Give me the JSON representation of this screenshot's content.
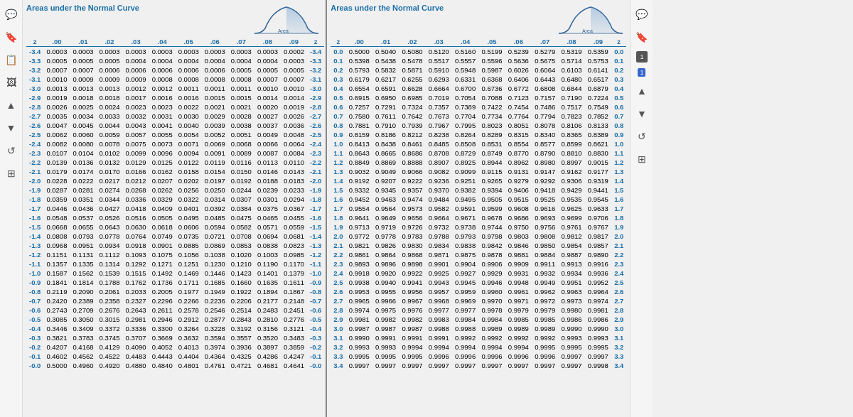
{
  "left_panel": {
    "title": "Areas under the Normal Curve",
    "columns": [
      "z",
      ".00",
      ".01",
      ".02",
      ".03",
      ".04",
      ".05",
      ".06",
      ".07",
      ".08",
      ".09",
      "z"
    ],
    "rows": [
      [
        "-3.4",
        "0.0003",
        "0.0003",
        "0.0003",
        "0.0003",
        "0.0003",
        "0.0003",
        "0.0003",
        "0.0003",
        "0.0003",
        "0.0002",
        "-3.4"
      ],
      [
        "-3.3",
        "0.0005",
        "0.0005",
        "0.0005",
        "0.0004",
        "0.0004",
        "0.0004",
        "0.0004",
        "0.0004",
        "0.0004",
        "0.0003",
        "-3.3"
      ],
      [
        "-3.2",
        "0.0007",
        "0.0007",
        "0.0006",
        "0.0006",
        "0.0006",
        "0.0006",
        "0.0006",
        "0.0005",
        "0.0005",
        "0.0005",
        "-3.2"
      ],
      [
        "-3.1",
        "0.0010",
        "0.0009",
        "0.0009",
        "0.0009",
        "0.0008",
        "0.0008",
        "0.0008",
        "0.0008",
        "0.0007",
        "0.0007",
        "-3.1"
      ],
      [
        "-3.0",
        "0.0013",
        "0.0013",
        "0.0013",
        "0.0012",
        "0.0012",
        "0.0011",
        "0.0011",
        "0.0011",
        "0.0010",
        "0.0010",
        "-3.0"
      ],
      [
        "-2.9",
        "0.0019",
        "0.0018",
        "0.0018",
        "0.0017",
        "0.0016",
        "0.0016",
        "0.0015",
        "0.0015",
        "0.0014",
        "0.0014",
        "-2.9"
      ],
      [
        "-2.8",
        "0.0026",
        "0.0025",
        "0.0024",
        "0.0023",
        "0.0023",
        "0.0022",
        "0.0021",
        "0.0021",
        "0.0020",
        "0.0019",
        "-2.8"
      ],
      [
        "-2.7",
        "0.0035",
        "0.0034",
        "0.0033",
        "0.0032",
        "0.0031",
        "0.0030",
        "0.0029",
        "0.0028",
        "0.0027",
        "0.0026",
        "-2.7"
      ],
      [
        "-2.6",
        "0.0047",
        "0.0045",
        "0.0044",
        "0.0043",
        "0.0041",
        "0.0040",
        "0.0039",
        "0.0038",
        "0.0037",
        "0.0036",
        "-2.6"
      ],
      [
        "-2.5",
        "0.0062",
        "0.0060",
        "0.0059",
        "0.0057",
        "0.0055",
        "0.0054",
        "0.0052",
        "0.0051",
        "0.0049",
        "0.0048",
        "-2.5"
      ],
      [
        "-2.4",
        "0.0082",
        "0.0080",
        "0.0078",
        "0.0075",
        "0.0073",
        "0.0071",
        "0.0069",
        "0.0068",
        "0.0066",
        "0.0064",
        "-2.4"
      ],
      [
        "-2.3",
        "0.0107",
        "0.0104",
        "0.0102",
        "0.0099",
        "0.0096",
        "0.0094",
        "0.0091",
        "0.0089",
        "0.0087",
        "0.0084",
        "-2.3"
      ],
      [
        "-2.2",
        "0.0139",
        "0.0136",
        "0.0132",
        "0.0129",
        "0.0125",
        "0.0122",
        "0.0119",
        "0.0116",
        "0.0113",
        "0.0110",
        "-2.2"
      ],
      [
        "-2.1",
        "0.0179",
        "0.0174",
        "0.0170",
        "0.0166",
        "0.0162",
        "0.0158",
        "0.0154",
        "0.0150",
        "0.0146",
        "0.0143",
        "-2.1"
      ],
      [
        "-2.0",
        "0.0228",
        "0.0222",
        "0.0217",
        "0.0212",
        "0.0207",
        "0.0202",
        "0.0197",
        "0.0192",
        "0.0188",
        "0.0183",
        "-2.0"
      ],
      [
        "-1.9",
        "0.0287",
        "0.0281",
        "0.0274",
        "0.0268",
        "0.0262",
        "0.0256",
        "0.0250",
        "0.0244",
        "0.0239",
        "0.0233",
        "-1.9"
      ],
      [
        "-1.8",
        "0.0359",
        "0.0351",
        "0.0344",
        "0.0336",
        "0.0329",
        "0.0322",
        "0.0314",
        "0.0307",
        "0.0301",
        "0.0294",
        "-1.8"
      ],
      [
        "-1.7",
        "0.0446",
        "0.0436",
        "0.0427",
        "0.0418",
        "0.0409",
        "0.0401",
        "0.0392",
        "0.0384",
        "0.0375",
        "0.0367",
        "-1.7"
      ],
      [
        "-1.6",
        "0.0548",
        "0.0537",
        "0.0526",
        "0.0516",
        "0.0505",
        "0.0495",
        "0.0485",
        "0.0475",
        "0.0465",
        "0.0455",
        "-1.6"
      ],
      [
        "-1.5",
        "0.0668",
        "0.0655",
        "0.0643",
        "0.0630",
        "0.0618",
        "0.0606",
        "0.0594",
        "0.0582",
        "0.0571",
        "0.0559",
        "-1.5"
      ],
      [
        "-1.4",
        "0.0808",
        "0.0793",
        "0.0778",
        "0.0764",
        "0.0749",
        "0.0735",
        "0.0721",
        "0.0708",
        "0.0694",
        "0.0681",
        "-1.4"
      ],
      [
        "-1.3",
        "0.0968",
        "0.0951",
        "0.0934",
        "0.0918",
        "0.0901",
        "0.0885",
        "0.0869",
        "0.0853",
        "0.0838",
        "0.0823",
        "-1.3"
      ],
      [
        "-1.2",
        "0.1151",
        "0.1131",
        "0.1112",
        "0.1093",
        "0.1075",
        "0.1056",
        "0.1038",
        "0.1020",
        "0.1003",
        "0.0985",
        "-1.2"
      ],
      [
        "-1.1",
        "0.1357",
        "0.1335",
        "0.1314",
        "0.1292",
        "0.1271",
        "0.1251",
        "0.1230",
        "0.1210",
        "0.1190",
        "0.1170",
        "-1.1"
      ],
      [
        "-1.0",
        "0.1587",
        "0.1562",
        "0.1539",
        "0.1515",
        "0.1492",
        "0.1469",
        "0.1446",
        "0.1423",
        "0.1401",
        "0.1379",
        "-1.0"
      ],
      [
        "-0.9",
        "0.1841",
        "0.1814",
        "0.1788",
        "0.1762",
        "0.1736",
        "0.1711",
        "0.1685",
        "0.1660",
        "0.1635",
        "0.1611",
        "-0.9"
      ],
      [
        "-0.8",
        "0.2119",
        "0.2090",
        "0.2061",
        "0.2033",
        "0.2005",
        "0.1977",
        "0.1949",
        "0.1922",
        "0.1894",
        "0.1867",
        "-0.8"
      ],
      [
        "-0.7",
        "0.2420",
        "0.2389",
        "0.2358",
        "0.2327",
        "0.2296",
        "0.2266",
        "0.2236",
        "0.2206",
        "0.2177",
        "0.2148",
        "-0.7"
      ],
      [
        "-0.6",
        "0.2743",
        "0.2709",
        "0.2676",
        "0.2643",
        "0.2611",
        "0.2578",
        "0.2546",
        "0.2514",
        "0.2483",
        "0.2451",
        "-0.6"
      ],
      [
        "-0.5",
        "0.3085",
        "0.3050",
        "0.3015",
        "0.2981",
        "0.2946",
        "0.2912",
        "0.2877",
        "0.2843",
        "0.2810",
        "0.2776",
        "-0.5"
      ],
      [
        "-0.4",
        "0.3446",
        "0.3409",
        "0.3372",
        "0.3336",
        "0.3300",
        "0.3264",
        "0.3228",
        "0.3192",
        "0.3156",
        "0.3121",
        "-0.4"
      ],
      [
        "-0.3",
        "0.3821",
        "0.3783",
        "0.3745",
        "0.3707",
        "0.3669",
        "0.3632",
        "0.3594",
        "0.3557",
        "0.3520",
        "0.3483",
        "-0.3"
      ],
      [
        "-0.2",
        "0.4207",
        "0.4168",
        "0.4129",
        "0.4090",
        "0.4052",
        "0.4013",
        "0.3974",
        "0.3936",
        "0.3897",
        "0.3859",
        "-0.2"
      ],
      [
        "-0.1",
        "0.4602",
        "0.4562",
        "0.4522",
        "0.4483",
        "0.4443",
        "0.4404",
        "0.4364",
        "0.4325",
        "0.4286",
        "0.4247",
        "-0.1"
      ],
      [
        "-0.0",
        "0.5000",
        "0.4960",
        "0.4920",
        "0.4880",
        "0.4840",
        "0.4801",
        "0.4761",
        "0.4721",
        "0.4681",
        "0.4641",
        "-0.0"
      ]
    ]
  },
  "right_panel": {
    "title": "Areas under the Normal Curve",
    "columns": [
      "z",
      ".00",
      ".01",
      ".02",
      ".03",
      ".04",
      ".05",
      ".06",
      ".07",
      ".08",
      ".09",
      "z"
    ],
    "rows": [
      [
        "0.0",
        "0.5000",
        "0.5040",
        "0.5080",
        "0.5120",
        "0.5160",
        "0.5199",
        "0.5239",
        "0.5279",
        "0.5319",
        "0.5359",
        "0.0"
      ],
      [
        "0.1",
        "0.5398",
        "0.5438",
        "0.5478",
        "0.5517",
        "0.5557",
        "0.5596",
        "0.5636",
        "0.5675",
        "0.5714",
        "0.5753",
        "0.1"
      ],
      [
        "0.2",
        "0.5793",
        "0.5832",
        "0.5871",
        "0.5910",
        "0.5948",
        "0.5987",
        "0.6026",
        "0.6064",
        "0.6103",
        "0.6141",
        "0.2"
      ],
      [
        "0.3",
        "0.6179",
        "0.6217",
        "0.6255",
        "0.6293",
        "0.6331",
        "0.6368",
        "0.6406",
        "0.6443",
        "0.6480",
        "0.6517",
        "0.3"
      ],
      [
        "0.4",
        "0.6554",
        "0.6591",
        "0.6628",
        "0.6664",
        "0.6700",
        "0.6736",
        "0.6772",
        "0.6808",
        "0.6844",
        "0.6879",
        "0.4"
      ],
      [
        "0.5",
        "0.6915",
        "0.6950",
        "0.6985",
        "0.7019",
        "0.7054",
        "0.7088",
        "0.7123",
        "0.7157",
        "0.7190",
        "0.7224",
        "0.5"
      ],
      [
        "0.6",
        "0.7257",
        "0.7291",
        "0.7324",
        "0.7357",
        "0.7389",
        "0.7422",
        "0.7454",
        "0.7486",
        "0.7517",
        "0.7549",
        "0.6"
      ],
      [
        "0.7",
        "0.7580",
        "0.7611",
        "0.7642",
        "0.7673",
        "0.7704",
        "0.7734",
        "0.7764",
        "0.7794",
        "0.7823",
        "0.7852",
        "0.7"
      ],
      [
        "0.8",
        "0.7881",
        "0.7910",
        "0.7939",
        "0.7967",
        "0.7995",
        "0.8023",
        "0.8051",
        "0.8078",
        "0.8106",
        "0.8133",
        "0.8"
      ],
      [
        "0.9",
        "0.8159",
        "0.8186",
        "0.8212",
        "0.8238",
        "0.8264",
        "0.8289",
        "0.8315",
        "0.8340",
        "0.8365",
        "0.8389",
        "0.9"
      ],
      [
        "1.0",
        "0.8413",
        "0.8438",
        "0.8461",
        "0.8485",
        "0.8508",
        "0.8531",
        "0.8554",
        "0.8577",
        "0.8599",
        "0.8621",
        "1.0"
      ],
      [
        "1.1",
        "0.8643",
        "0.8665",
        "0.8686",
        "0.8708",
        "0.8729",
        "0.8749",
        "0.8770",
        "0.8790",
        "0.8810",
        "0.8830",
        "1.1"
      ],
      [
        "1.2",
        "0.8849",
        "0.8869",
        "0.8888",
        "0.8907",
        "0.8925",
        "0.8944",
        "0.8962",
        "0.8980",
        "0.8997",
        "0.9015",
        "1.2"
      ],
      [
        "1.3",
        "0.9032",
        "0.9049",
        "0.9066",
        "0.9082",
        "0.9099",
        "0.9115",
        "0.9131",
        "0.9147",
        "0.9162",
        "0.9177",
        "1.3"
      ],
      [
        "1.4",
        "0.9192",
        "0.9207",
        "0.9222",
        "0.9236",
        "0.9251",
        "0.9265",
        "0.9279",
        "0.9292",
        "0.9306",
        "0.9319",
        "1.4"
      ],
      [
        "1.5",
        "0.9332",
        "0.9345",
        "0.9357",
        "0.9370",
        "0.9382",
        "0.9394",
        "0.9406",
        "0.9418",
        "0.9429",
        "0.9441",
        "1.5"
      ],
      [
        "1.6",
        "0.9452",
        "0.9463",
        "0.9474",
        "0.9484",
        "0.9495",
        "0.9505",
        "0.9515",
        "0.9525",
        "0.9535",
        "0.9545",
        "1.6"
      ],
      [
        "1.7",
        "0.9554",
        "0.9564",
        "0.9573",
        "0.9582",
        "0.9591",
        "0.9599",
        "0.9608",
        "0.9616",
        "0.9625",
        "0.9633",
        "1.7"
      ],
      [
        "1.8",
        "0.9641",
        "0.9649",
        "0.9656",
        "0.9664",
        "0.9671",
        "0.9678",
        "0.9686",
        "0.9693",
        "0.9699",
        "0.9706",
        "1.8"
      ],
      [
        "1.9",
        "0.9713",
        "0.9719",
        "0.9726",
        "0.9732",
        "0.9738",
        "0.9744",
        "0.9750",
        "0.9756",
        "0.9761",
        "0.9767",
        "1.9"
      ],
      [
        "2.0",
        "0.9772",
        "0.9778",
        "0.9783",
        "0.9788",
        "0.9793",
        "0.9798",
        "0.9803",
        "0.9808",
        "0.9812",
        "0.9817",
        "2.0"
      ],
      [
        "2.1",
        "0.9821",
        "0.9826",
        "0.9830",
        "0.9834",
        "0.9838",
        "0.9842",
        "0.9846",
        "0.9850",
        "0.9854",
        "0.9857",
        "2.1"
      ],
      [
        "2.2",
        "0.9861",
        "0.9864",
        "0.9868",
        "0.9871",
        "0.9875",
        "0.9878",
        "0.9881",
        "0.9884",
        "0.9887",
        "0.9890",
        "2.2"
      ],
      [
        "2.3",
        "0.9893",
        "0.9896",
        "0.9898",
        "0.9901",
        "0.9904",
        "0.9906",
        "0.9909",
        "0.9911",
        "0.9913",
        "0.9916",
        "2.3"
      ],
      [
        "2.4",
        "0.9918",
        "0.9920",
        "0.9922",
        "0.9925",
        "0.9927",
        "0.9929",
        "0.9931",
        "0.9932",
        "0.9934",
        "0.9936",
        "2.4"
      ],
      [
        "2.5",
        "0.9938",
        "0.9940",
        "0.9941",
        "0.9943",
        "0.9945",
        "0.9946",
        "0.9948",
        "0.9949",
        "0.9951",
        "0.9952",
        "2.5"
      ],
      [
        "2.6",
        "0.9953",
        "0.9955",
        "0.9956",
        "0.9957",
        "0.9959",
        "0.9960",
        "0.9961",
        "0.9962",
        "0.9963",
        "0.9964",
        "2.6"
      ],
      [
        "2.7",
        "0.9965",
        "0.9966",
        "0.9967",
        "0.9968",
        "0.9969",
        "0.9970",
        "0.9971",
        "0.9972",
        "0.9973",
        "0.9974",
        "2.7"
      ],
      [
        "2.8",
        "0.9974",
        "0.9975",
        "0.9976",
        "0.9977",
        "0.9977",
        "0.9978",
        "0.9979",
        "0.9979",
        "0.9980",
        "0.9981",
        "2.8"
      ],
      [
        "2.9",
        "0.9981",
        "0.9982",
        "0.9982",
        "0.9983",
        "0.9984",
        "0.9984",
        "0.9985",
        "0.9985",
        "0.9986",
        "0.9986",
        "2.9"
      ],
      [
        "3.0",
        "0.9987",
        "0.9987",
        "0.9987",
        "0.9988",
        "0.9988",
        "0.9989",
        "0.9989",
        "0.9989",
        "0.9990",
        "0.9990",
        "3.0"
      ],
      [
        "3.1",
        "0.9990",
        "0.9991",
        "0.9991",
        "0.9991",
        "0.9992",
        "0.9992",
        "0.9992",
        "0.9992",
        "0.9993",
        "0.9993",
        "3.1"
      ],
      [
        "3.2",
        "0.9993",
        "0.9993",
        "0.9994",
        "0.9994",
        "0.9994",
        "0.9994",
        "0.9994",
        "0.9995",
        "0.9995",
        "0.9995",
        "3.2"
      ],
      [
        "3.3",
        "0.9995",
        "0.9995",
        "0.9995",
        "0.9996",
        "0.9996",
        "0.9996",
        "0.9996",
        "0.9996",
        "0.9997",
        "0.9997",
        "3.3"
      ],
      [
        "3.4",
        "0.9997",
        "0.9997",
        "0.9997",
        "0.9997",
        "0.9997",
        "0.9997",
        "0.9997",
        "0.9997",
        "0.9997",
        "0.9998",
        "3.4"
      ]
    ]
  },
  "sidebar_icons": {
    "chat": "💬",
    "bookmark": "🔖",
    "copy": "📋",
    "image": "🖼",
    "up_arrow": "▲",
    "down_arrow": "▼",
    "refresh": "↺",
    "grid": "⊞"
  },
  "page_badge": "1",
  "blue_label": "1"
}
